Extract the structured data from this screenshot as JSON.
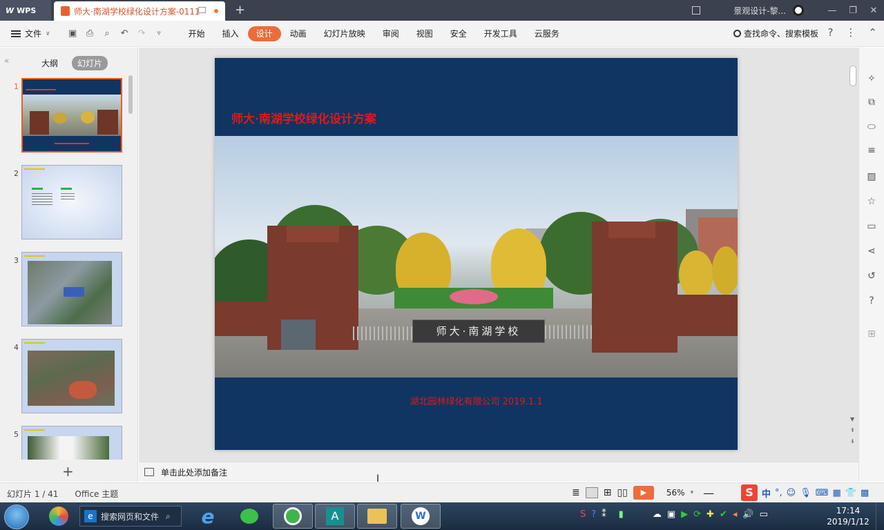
{
  "titlebar": {
    "app_name": "WPS",
    "doc_tab_title": "师大·南湖学校绿化设计方案-0111",
    "new_tab": "+",
    "user_name": "景观设计-黎...",
    "window_buttons": [
      "—",
      "❐",
      "✕"
    ]
  },
  "menubar": {
    "file_label": "文件",
    "quick_access": [
      "save-icon",
      "print-icon",
      "preview-icon",
      "undo-icon",
      "redo-icon",
      "more-icon"
    ],
    "tabs": [
      "开始",
      "插入",
      "设计",
      "动画",
      "幻灯片放映",
      "审阅",
      "视图",
      "安全",
      "开发工具",
      "云服务"
    ],
    "active_tab": "设计",
    "search_label": "查找命令、搜索模板",
    "help": "?",
    "more": "⋮"
  },
  "left_panel": {
    "outline_tab": "大纲",
    "slides_tab": "幻灯片",
    "thumbnails": [
      {
        "num": "1",
        "selected": true
      },
      {
        "num": "2",
        "selected": false
      },
      {
        "num": "3",
        "selected": false
      },
      {
        "num": "4",
        "selected": false
      },
      {
        "num": "5",
        "selected": false
      }
    ]
  },
  "slide": {
    "title": "师大·南湖学校绿化设计方案",
    "footer": "湖北园林绿化有限公司  2019.1.1",
    "gate_sign": "师大·南湖学校",
    "colors": {
      "background": "#103562",
      "title_text": "#e01818"
    }
  },
  "notes": {
    "placeholder": "单击此处添加备注"
  },
  "statusbar": {
    "slide_counter": "幻灯片 1 / 41",
    "theme": "Office 主题",
    "zoom": "56%"
  },
  "ime": {
    "lang": "中"
  },
  "taskbar": {
    "search_placeholder": "搜索网页和文件",
    "clock_time": "17:14",
    "clock_date": "2019/1/12"
  }
}
